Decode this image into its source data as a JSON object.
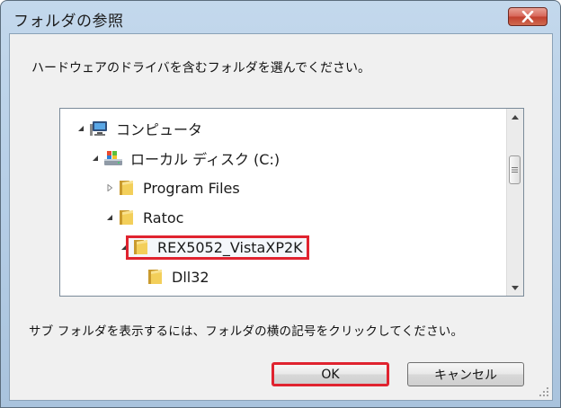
{
  "window": {
    "title": "フォルダの参照",
    "description": "ハードウェアのドライバを含むフォルダを選んでください。",
    "hint": "サブ フォルダを表示するには、フォルダの横の記号をクリックしてください。"
  },
  "tree": {
    "items": [
      {
        "label": "コンピュータ",
        "icon": "computer-icon",
        "expanded": true
      },
      {
        "label": "ローカル ディスク (C:)",
        "icon": "drive-icon",
        "expanded": true
      },
      {
        "label": "Program Files",
        "icon": "folder-icon",
        "expanded": false
      },
      {
        "label": "Ratoc",
        "icon": "folder-icon",
        "expanded": true
      },
      {
        "label": "REX5052_VistaXP2K",
        "icon": "folder-icon",
        "expanded": true,
        "selected": true
      },
      {
        "label": "Dll32",
        "icon": "folder-icon"
      }
    ]
  },
  "buttons": {
    "ok": "OK",
    "cancel": "キャンセル"
  },
  "colors": {
    "highlight": "#e0232f",
    "client_bg": "#f0f0f0",
    "frame": "#b7cfe7"
  }
}
